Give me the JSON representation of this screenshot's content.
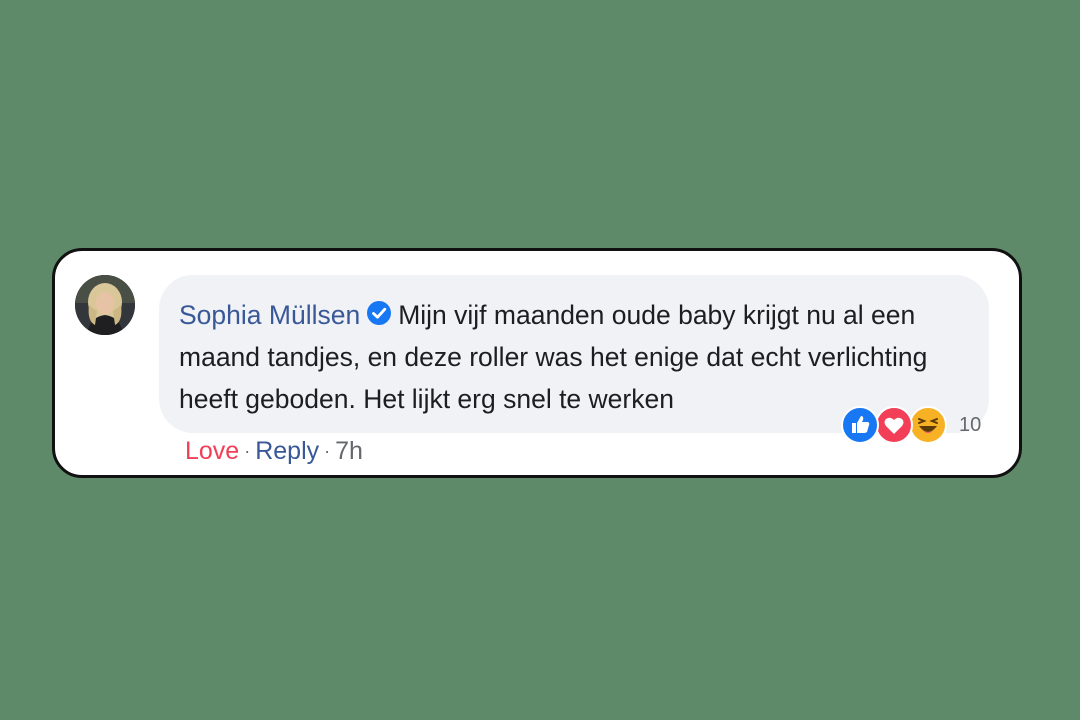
{
  "comment": {
    "author_name": "Sophia Müllsen",
    "text": "Mijn vijf maanden oude baby krijgt nu al een maand tandjes, en deze roller was het enige dat echt verlichting heeft geboden. Het lijkt erg snel te werken",
    "reaction_count": "10",
    "reactions": [
      "like-icon",
      "love-icon",
      "haha-icon"
    ]
  },
  "actions": {
    "love_label": "Love",
    "separator": "·",
    "reply_label": "Reply",
    "timestamp": "7h"
  },
  "colors": {
    "background": "#5f8a69",
    "name": "#385898",
    "love": "#f33e58",
    "like": "#1877f2",
    "haha": "#f7b125"
  }
}
